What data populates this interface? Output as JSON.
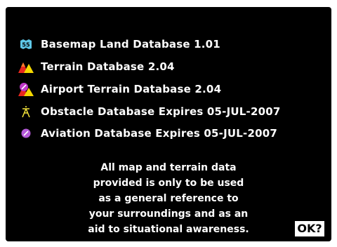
{
  "databases": [
    {
      "label": "Basemap Land Database 1.01",
      "icon": "basemap-icon"
    },
    {
      "label": "Terrain Database 2.04",
      "icon": "terrain-icon"
    },
    {
      "label": "Airport Terrain Database 2.04",
      "icon": "airport-terrain-icon"
    },
    {
      "label": "Obstacle Database Expires 05-JUL-2007",
      "icon": "obstacle-icon"
    },
    {
      "label": "Aviation Database Expires 05-JUL-2007",
      "icon": "aviation-icon"
    }
  ],
  "disclaimer": {
    "lines": [
      "All map and terrain data",
      "provided is only to be used",
      "as a general reference to",
      "your surroundings and as an",
      "aid to situational awareness."
    ]
  },
  "ok_button": {
    "label": "OK?"
  },
  "colors": {
    "background": "#000000",
    "text": "#ffffff",
    "basemap_icon": "#5fc8e8",
    "terrain_red": "#e8281e",
    "terrain_yellow": "#f5d800",
    "airport_magenta": "#c038c8",
    "obstacle_yellow": "#f2e23a",
    "aviation_magenta": "#b45ad8"
  }
}
